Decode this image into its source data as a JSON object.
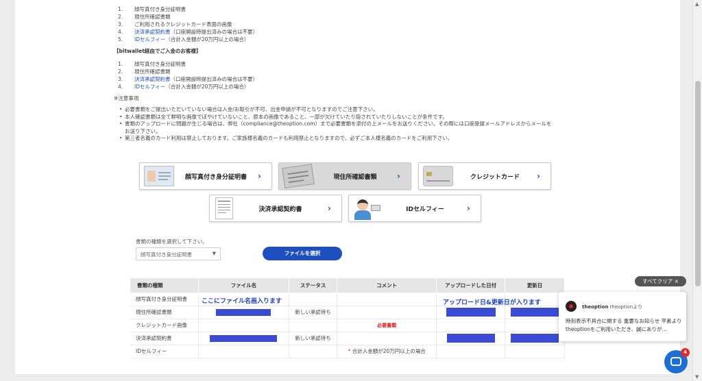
{
  "credit_list": [
    {
      "num": "1.",
      "text": "顔写真付き身分証明書",
      "note": ""
    },
    {
      "num": "2.",
      "text": "現住所確認書類",
      "note": ""
    },
    {
      "num": "3.",
      "text": "ご利用されるクレジットカード表面の画像",
      "note": ""
    },
    {
      "num": "4.",
      "text": "決済承認契約書",
      "note": "（口座開設時提出済みの場合は不要）",
      "link": true
    },
    {
      "num": "5.",
      "text": "IDセルフィー",
      "note": "（合計入金額が20万円以上の場合）",
      "link": true
    }
  ],
  "bitwallet_heading": "【bitwallet経由でご入金のお客様】",
  "bitwallet_list": [
    {
      "num": "1.",
      "text": "顔写真付き身分証明書",
      "note": ""
    },
    {
      "num": "2.",
      "text": "現住所確認書類",
      "note": ""
    },
    {
      "num": "3.",
      "text": "決済承認契約書",
      "note": "（口座開設時提出済みの場合は不要）",
      "link": true
    },
    {
      "num": "4.",
      "text": "IDセルフィー",
      "note": "（合計入金額が20万円以上の場合）",
      "link": true
    }
  ],
  "notes_title": "※注意事項",
  "notes": [
    "必要書類をご提出いただいていない場合は入金/お取引が不可、出金申請が不可となりますのでご注意下さい。",
    "本人確認書類は全て鮮明な画像でぼやけていないこと、原本の画像であること、一部が欠けていたり隠されていたりしないことが条件です。",
    "書類のアップロードに問題が生じる場合は、弊社（compliance@theoption.com）まで必要書類を添付の上メールをお送りください。その際には口座登録メールアドレスからメールをお送り下さい。",
    "第三者名義のカード利用は禁止しております。ご家族様名義のカードも利用禁止となりますので、必ずご本人様名義のカードをご利用下さい。"
  ],
  "doc_buttons": {
    "id_card": "顔写真付き身分証明書",
    "address": "現住所確認書類",
    "credit": "クレジットカード",
    "agreement": "決済承認契約書",
    "selfie": "IDセルフィー"
  },
  "upload": {
    "select_label": "書類の種類を選択して下さい。",
    "select_value": "顔写真付き身分証明書",
    "file_button": "ファイルを選択"
  },
  "table": {
    "headers": [
      "書類の種類",
      "ファイル名",
      "ステータス",
      "コメント",
      "アップロードした日付",
      "更新日"
    ],
    "rows": [
      {
        "type": "顔写真付き身分証明書",
        "status": "",
        "comment": ""
      },
      {
        "type": "現住所確認書類",
        "status": "新しい承認待ち",
        "comment": ""
      },
      {
        "type": "クレジットカード画像",
        "status": "",
        "comment": "必要書類"
      },
      {
        "type": "決済承認契約書",
        "status": "新しい承認待ち",
        "comment": ""
      },
      {
        "type": "IDセルフィー",
        "status": "",
        "comment": "合計入金額が20万円以上の場合",
        "star": "*"
      }
    ],
    "annot_filename": "ここにファイル名画入ります",
    "annot_dates": "アップロード日&更新日が入ります"
  },
  "notification": {
    "clear_all": "すべてクリア ×",
    "sender_name": "theoption",
    "sender_rest": " theoptionより",
    "message": "時刻表示不具合に関する 重要なお知らせ 平素よりtheoptionをご利用いただき、誠にありが…"
  },
  "chat": {
    "badge": "4"
  },
  "colors": {
    "accent": "#1d4fbf",
    "redacted": "#3b4bd6",
    "required": "#d52121"
  }
}
